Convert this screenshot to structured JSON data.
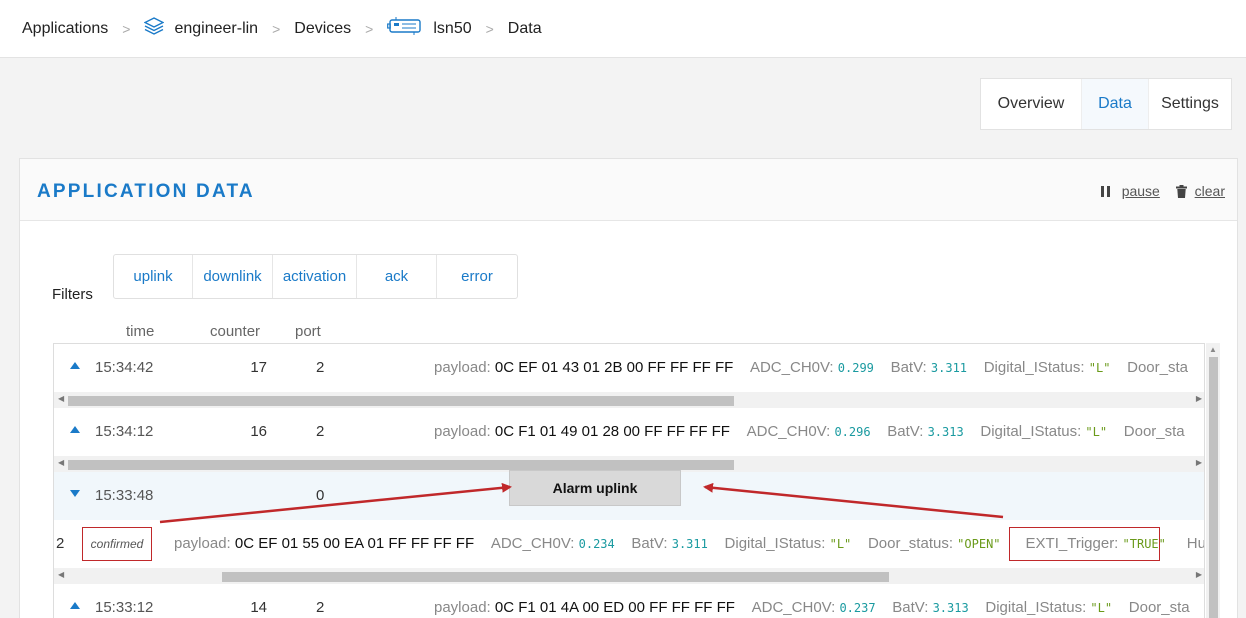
{
  "breadcrumb": {
    "items": [
      "Applications",
      "engineer-lin",
      "Devices",
      "lsn50",
      "Data"
    ],
    "separator": ">"
  },
  "tabs": [
    {
      "label": "Overview",
      "active": false
    },
    {
      "label": "Data",
      "active": true
    },
    {
      "label": "Settings",
      "active": false
    }
  ],
  "panel": {
    "title": "APPLICATION DATA",
    "pause_label": "pause",
    "clear_label": "clear"
  },
  "filters": {
    "label": "Filters",
    "buttons": [
      "uplink",
      "downlink",
      "activation",
      "ack",
      "error"
    ]
  },
  "columns": {
    "time": "time",
    "counter": "counter",
    "port": "port"
  },
  "rows": [
    {
      "time": "15:34:42",
      "counter": "17",
      "port": "2",
      "payload_label": "payload:",
      "payload": "0C EF 01 43 01 2B 00 FF FF FF FF",
      "adc_label": "ADC_CH0V:",
      "adc": "0.299",
      "batv_label": "BatV:",
      "batv": "3.311",
      "dig_label": "Digital_IStatus:",
      "dig": "\"L\"",
      "door_label": "Door_sta"
    },
    {
      "time": "15:34:12",
      "counter": "16",
      "port": "2",
      "payload_label": "payload:",
      "payload": "0C F1 01 49 01 28 00 FF FF FF FF",
      "adc_label": "ADC_CH0V:",
      "adc": "0.296",
      "batv_label": "BatV:",
      "batv": "3.313",
      "dig_label": "Digital_IStatus:",
      "dig": "\"L\"",
      "door_label": "Door_sta"
    },
    {
      "time": "15:33:48",
      "counter": "",
      "port": "0",
      "expanded": true
    },
    {
      "time": "15:33:12",
      "counter": "14",
      "port": "2",
      "payload_label": "payload:",
      "payload": "0C F1 01 4A 00 ED 00 FF FF FF FF",
      "adc_label": "ADC_CH0V:",
      "adc": "0.237",
      "batv_label": "BatV:",
      "batv": "3.313",
      "dig_label": "Digital_IStatus:",
      "dig": "\"L\"",
      "door_label": "Door_sta"
    }
  ],
  "expanded_detail": {
    "port": "2",
    "confirmed": "confirmed",
    "payload_label": "payload:",
    "payload": "0C EF 01 55 00 EA 01 FF FF FF FF",
    "adc_label": "ADC_CH0V:",
    "adc": "0.234",
    "batv_label": "BatV:",
    "batv": "3.311",
    "dig_label": "Digital_IStatus:",
    "dig": "\"L\"",
    "door_label": "Door_status:",
    "door": "\"OPEN\"",
    "exti_label": "EXTI_Trigger:",
    "exti": "\"TRUE\"",
    "hu_label": "Hu"
  },
  "annotation": {
    "label": "Alarm uplink",
    "color": "#c0282a"
  },
  "icons": {
    "app": "layers-icon",
    "device": "device-icon",
    "pause": "pause-icon",
    "clear": "trash-icon"
  },
  "colors": {
    "accent": "#1a7ac8",
    "annotation": "#c0282a"
  }
}
